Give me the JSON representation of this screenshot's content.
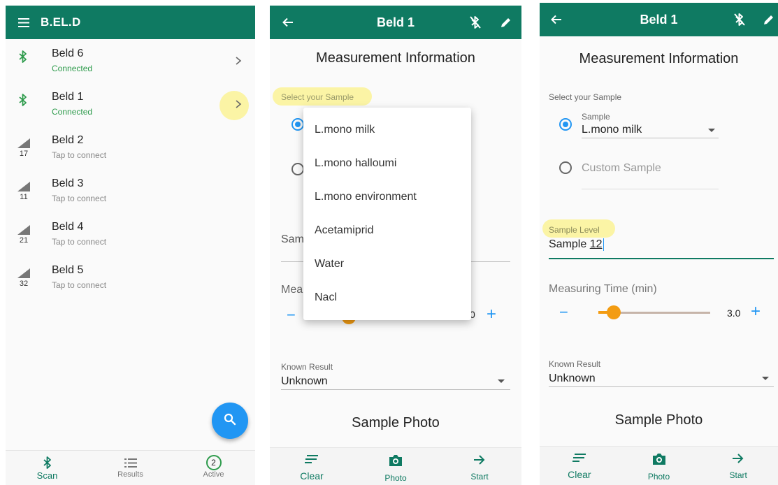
{
  "screen1": {
    "app_title": "B.EL.D",
    "devices": [
      {
        "name": "Beld 6",
        "status": "Connected",
        "signal": ""
      },
      {
        "name": "Beld 1",
        "status": "Connected",
        "signal": ""
      },
      {
        "name": "Beld 2",
        "status": "Tap to connect",
        "signal": "17"
      },
      {
        "name": "Beld 3",
        "status": "Tap to connect",
        "signal": "11"
      },
      {
        "name": "Beld 4",
        "status": "Tap to connect",
        "signal": "21"
      },
      {
        "name": "Beld 5",
        "status": "Tap to connect",
        "signal": "32"
      }
    ],
    "nav": {
      "scan": "Scan",
      "results": "Results",
      "active": "Active",
      "active_count": "2"
    },
    "icons": {
      "menu": "hamburger-icon",
      "bluetooth": "bluetooth-icon",
      "signal": "signal-icon",
      "chevron": "chevron-right-icon",
      "search": "search-icon",
      "list": "list-icon"
    }
  },
  "screen2": {
    "title": "Beld 1",
    "heading": "Measurement Information",
    "select_label": "Select your Sample",
    "menu_items": [
      "L.mono milk",
      "L.mono halloumi",
      "L.mono environment",
      "Acetamiprid",
      "Water",
      "Nacl"
    ],
    "sample_level_partial": "Sam",
    "measuring_partial": "Mea",
    "value_partial": "0",
    "known_label": "Known Result",
    "known_value": "Unknown",
    "photo_heading": "Sample Photo",
    "toolbar": {
      "clear": "Clear",
      "photo": "Photo",
      "start": "Start"
    }
  },
  "screen3": {
    "title": "Beld 1",
    "heading": "Measurement Information",
    "select_label": "Select your Sample",
    "sample_label": "Sample",
    "sample_value": "L.mono milk",
    "custom_label": "Custom Sample",
    "level_label": "Sample Level",
    "level_prefix": "Sample ",
    "level_num": "12",
    "time_label": "Measuring Time (min)",
    "time_value": "3.0",
    "time_fraction": 0.14,
    "known_label": "Known Result",
    "known_value": "Unknown",
    "photo_heading": "Sample Photo",
    "toolbar": {
      "clear": "Clear",
      "photo": "Photo",
      "start": "Start"
    }
  },
  "colors": {
    "primary": "#0f7a62",
    "accent": "#2196f3",
    "slider": "#f39c12",
    "highlight": "#fbf4a5",
    "connected": "#2e9b4c"
  }
}
